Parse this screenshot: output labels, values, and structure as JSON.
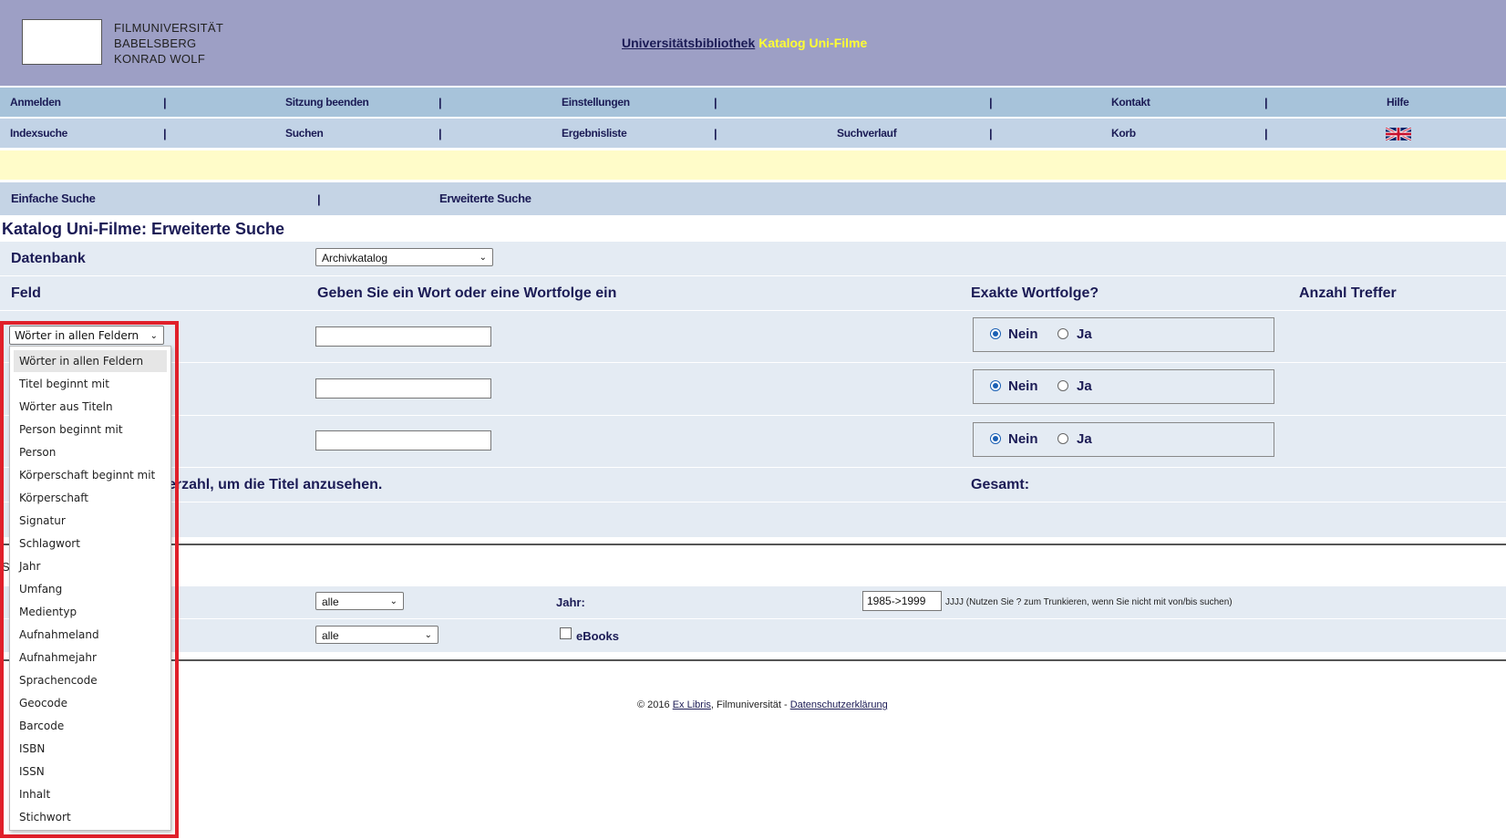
{
  "header": {
    "logo_lines": [
      "FILMUNIVERSITÄT",
      "BABELSBERG",
      "KONRAD WOLF"
    ],
    "library_link": "Universitätsbibliothek",
    "catalog_name": "Katalog Uni-Filme"
  },
  "nav_top": [
    "Anmelden",
    "Sitzung beenden",
    "Einstellungen",
    "",
    "Kontakt",
    "Hilfe"
  ],
  "nav_bottom": [
    "Indexsuche",
    "Suchen",
    "Ergebnisliste",
    "Suchverlauf",
    "Korb"
  ],
  "separator": "|",
  "tabs": {
    "simple": "Einfache Suche",
    "advanced": "Erweiterte Suche"
  },
  "page_title": "Katalog Uni-Filme: Erweiterte Suche",
  "database": {
    "label": "Datenbank",
    "value": "Archivkatalog"
  },
  "columns": {
    "field": "Feld",
    "input": "Geben Sie ein Wort oder eine Wortfolge ein",
    "exact": "Exakte Wortfolge?",
    "hits": "Anzahl Treffer"
  },
  "radio": {
    "no": "Nein",
    "yes": "Ja"
  },
  "hint_text": "erzahl, um die Titel anzusehen.",
  "total_label": "Gesamt:",
  "filters": {
    "select1_value": "alle",
    "select2_value": "alle",
    "year_label": "Jahr:",
    "year_value": "1985->1999",
    "year_hint": "JJJJ (Nutzen Sie ? zum Trunkieren, wenn Sie nicht mit von/bis suchen)",
    "ebooks_label": "eBooks",
    "cut_letter": "S"
  },
  "field_dropdown": {
    "selected": "Wörter in allen Feldern",
    "options": [
      "Wörter in allen Feldern",
      "Titel beginnt mit",
      "Wörter aus Titeln",
      "Person beginnt mit",
      "Person",
      "Körperschaft beginnt mit",
      "Körperschaft",
      "Signatur",
      "Schlagwort",
      "Jahr",
      "Umfang",
      "Medientyp",
      "Aufnahmeland",
      "Aufnahmejahr",
      "Sprachencode",
      "Geocode",
      "Barcode",
      "ISBN",
      "ISSN",
      "Inhalt",
      "Stichwort"
    ]
  },
  "footer": {
    "copyright": "© 2016",
    "exlibris": "Ex Libris",
    "middle": ", Filmuniversität - ",
    "privacy": "Datenschutzerklärung"
  },
  "colors": {
    "header_bg": "#9d9fc5",
    "nav1_bg": "#a7c3da",
    "nav2_bg": "#c2d3e6",
    "yellow_bar": "#fffcc9",
    "accent_text": "#1b1b55",
    "highlight": "#e0202a"
  },
  "icons": {
    "flag": "uk-flag-icon",
    "chevron": "chevron-down-icon"
  }
}
